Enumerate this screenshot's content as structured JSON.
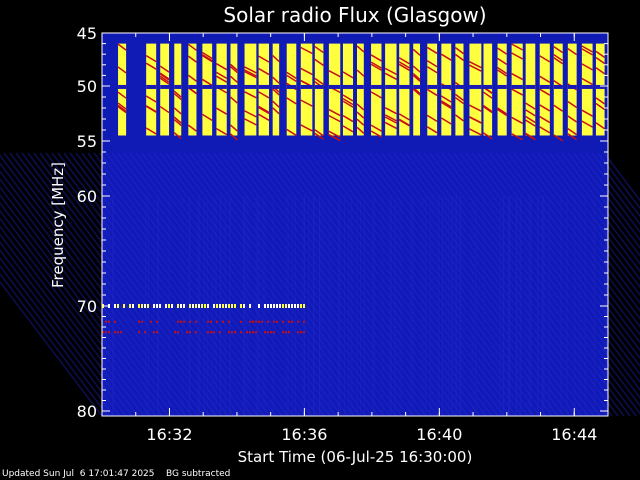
{
  "chart_data": {
    "type": "heatmap",
    "title": "Solar radio Flux (Glasgow)",
    "xlabel": "Start Time (06-Jul-25 16:30:00)",
    "ylabel": "Frequency [MHz]",
    "xlim": [
      "16:30:00",
      "16:45:00"
    ],
    "ylim": [
      45,
      80
    ],
    "x_ticks": [
      "16:32",
      "16:36",
      "16:40",
      "16:44"
    ],
    "y_ticks": [
      45,
      50,
      55,
      60,
      70,
      80
    ],
    "colormap": [
      "#1010c8",
      "#c81010",
      "#ffff40",
      "#ffffff"
    ],
    "background_color": "#101ab4",
    "features": [
      {
        "kind": "striped_interference_band",
        "freq_range_mhz": [
          46,
          54.5
        ],
        "time_range": [
          "16:30:00",
          "16:45:00"
        ],
        "intensity": "high"
      },
      {
        "kind": "narrowband_emission",
        "freq_mhz": 70,
        "time_range": [
          "16:30:00",
          "16:36:00"
        ],
        "intensity": "high"
      },
      {
        "kind": "narrowband_emission",
        "freq_mhz": 71.5,
        "time_range": [
          "16:30:00",
          "16:36:00"
        ],
        "intensity": "medium"
      },
      {
        "kind": "narrowband_emission",
        "freq_mhz": 72.5,
        "time_range": [
          "16:30:00",
          "16:36:00"
        ],
        "intensity": "medium"
      }
    ]
  },
  "footer": {
    "updated": "Updated Sun Jul  6 17:01:47 2025",
    "note": "BG subtracted"
  }
}
